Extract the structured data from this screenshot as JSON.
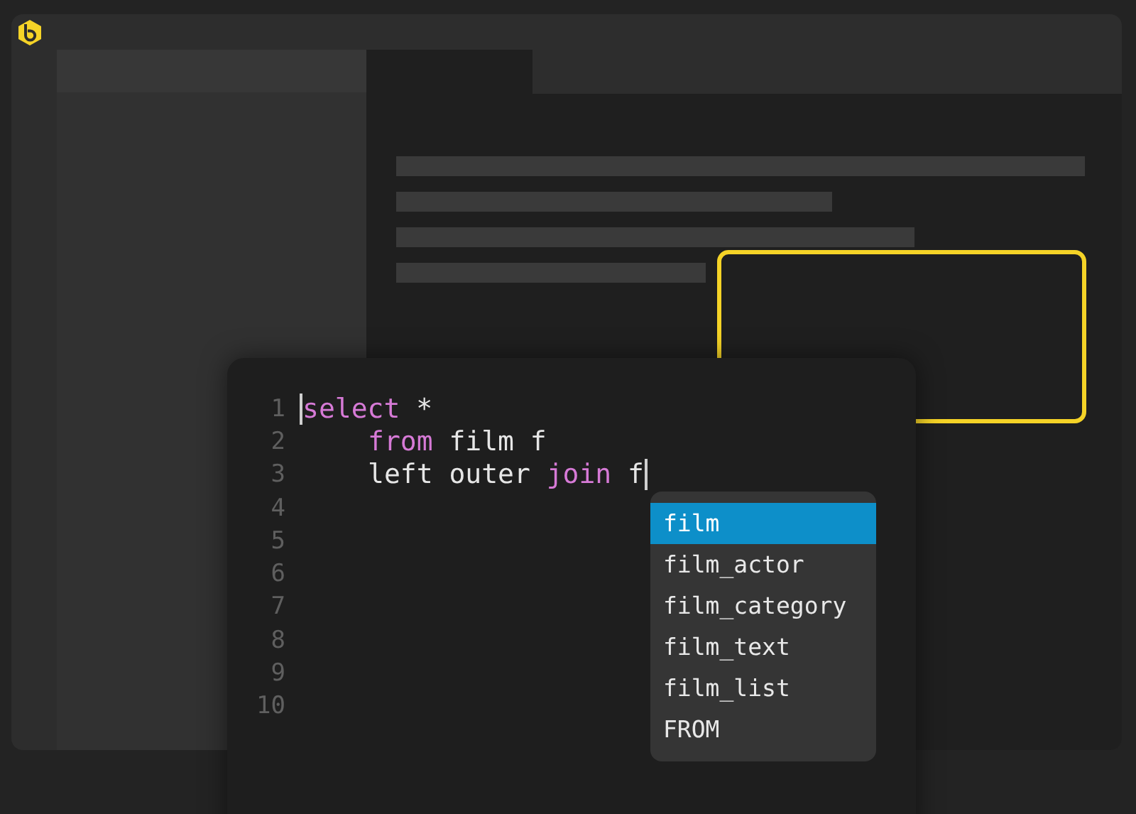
{
  "editor": {
    "lines": [
      {
        "number": "1",
        "indented": false,
        "caret_before": true,
        "caret_after": false,
        "tokens": [
          {
            "text": "select",
            "kind": "keyword"
          },
          {
            "text": " *",
            "kind": "plain"
          }
        ]
      },
      {
        "number": "2",
        "indented": true,
        "caret_before": false,
        "caret_after": false,
        "tokens": [
          {
            "text": "from",
            "kind": "keyword"
          },
          {
            "text": " film f",
            "kind": "plain"
          }
        ]
      },
      {
        "number": "3",
        "indented": true,
        "caret_before": false,
        "caret_after": true,
        "tokens": [
          {
            "text": "left outer ",
            "kind": "plain"
          },
          {
            "text": "join",
            "kind": "keyword"
          },
          {
            "text": " f",
            "kind": "plain"
          }
        ]
      },
      {
        "number": "4"
      },
      {
        "number": "5"
      },
      {
        "number": "6"
      },
      {
        "number": "7"
      },
      {
        "number": "8"
      },
      {
        "number": "9"
      },
      {
        "number": "10"
      }
    ]
  },
  "autocomplete": [
    {
      "label": "film",
      "selected": true
    },
    {
      "label": "film_actor",
      "selected": false
    },
    {
      "label": "film_category",
      "selected": false
    },
    {
      "label": "film_text",
      "selected": false
    },
    {
      "label": "film_list",
      "selected": false
    },
    {
      "label": "FROM",
      "selected": false
    }
  ]
}
